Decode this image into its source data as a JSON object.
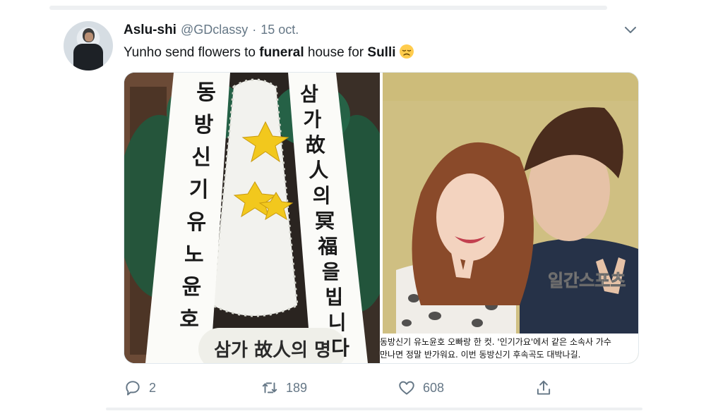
{
  "tweet": {
    "display_name": "Aslu-shi",
    "handle": "@GDclassy",
    "separator": "·",
    "date": "15 oct.",
    "text_parts": [
      "Yunho send flowers to ",
      "funeral",
      " house for ",
      "Sulli"
    ],
    "emoji": "disappointed-face-emoji"
  },
  "media": {
    "left_image": {
      "ribbon_left": [
        "동",
        "방",
        "신",
        "기",
        "유",
        "노",
        "윤",
        "호"
      ],
      "ribbon_right": [
        "삼",
        "가",
        "故",
        "人",
        "의",
        "冥",
        "福",
        "을",
        "빕",
        "니",
        "다"
      ],
      "bottom_sign": "삼가 故人의 명"
    },
    "right_image": {
      "watermark": "일간스포츠",
      "caption_line1": "동방신기 유노윤호 오빠랑 한 컷. '인기가요'에서 같은 소속사 가수",
      "caption_line2": "만나면 정말 반가워요. 이번 동방신기 후속곡도 대박나길."
    }
  },
  "actions": {
    "reply_count": "2",
    "retweet_count": "189",
    "like_count": "608"
  },
  "colors": {
    "secondary_text": "#657786",
    "background": "#ffffff"
  }
}
